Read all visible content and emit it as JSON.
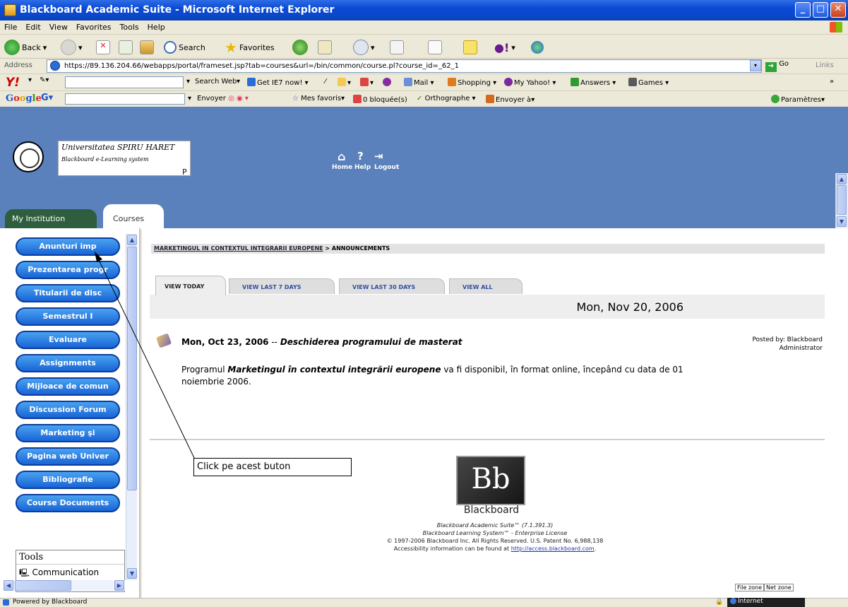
{
  "window": {
    "title": "Blackboard Academic Suite - Microsoft Internet Explorer"
  },
  "menu": [
    "File",
    "Edit",
    "View",
    "Favorites",
    "Tools",
    "Help"
  ],
  "toolbar": {
    "back": "Back",
    "search": "Search",
    "favorites": "Favorites"
  },
  "address": {
    "label": "Address",
    "url": "https://89.136.204.66/webapps/portal/frameset.jsp?tab=courses&url=/bin/common/course.pl?course_id=_62_1",
    "go": "Go",
    "links": "Links"
  },
  "yahoo": {
    "search_web": "Search Web",
    "get_ie7": "Get IE7 now!",
    "mail": "Mail",
    "shopping": "Shopping",
    "my_yahoo": "My Yahoo!",
    "answers": "Answers",
    "games": "Games"
  },
  "google": {
    "envoyer": "Envoyer",
    "favoris": "Mes favoris",
    "bloquees": "0 bloquée(s)",
    "orthographe": "Orthographe",
    "envoyer_a": "Envoyer à",
    "parametres": "Paramètres"
  },
  "header": {
    "university": "Universitatea SPIRU HARET",
    "subtitle": "Blackboard e-Learning system",
    "home": "Home",
    "help": "Help",
    "logout": "Logout",
    "p_mark": "P"
  },
  "tabs": {
    "institution": "My Institution",
    "courses": "Courses"
  },
  "course_menu": [
    "Anunturi imp",
    "Prezentarea progr",
    "Titularii de disc",
    "Semestrul I",
    "Evaluare",
    "Assignments",
    "Mijloace de comun",
    "Discussion Forum",
    "Marketing şi",
    "Pagina web Univer",
    "Bibliografie",
    "Course Documents"
  ],
  "tools": {
    "header": "Tools",
    "item": "Communication"
  },
  "breadcrumb": {
    "course": "MARKETINGUL IN CONTEXTUL INTEGRARII EUROPENE",
    "sep": " > ",
    "page": "ANNOUNCEMENTS"
  },
  "view_tabs": [
    "VIEW TODAY",
    "VIEW LAST 7 DAYS",
    "VIEW LAST 30 DAYS",
    "VIEW ALL"
  ],
  "current_date": "Mon, Nov 20, 2006",
  "announcement": {
    "date": "Mon, Oct 23, 2006",
    "dash": " -- ",
    "title": "Deschiderea programului de masterat",
    "posted_by": "Posted by: Blackboard Administrator",
    "body_pre": "Programul ",
    "body_bold": "Marketingul în contextul integrării europene",
    "body_post": " va fi disponibil, în format online, începând cu data de 01 noiembrie 2006."
  },
  "footer": {
    "bb_logo": "Bb",
    "brand": "Blackboard",
    "line1": "Blackboard Academic Suite™ (7.1.391.3)",
    "line2": "Blackboard Learning System™ - Enterprise License",
    "line3": "© 1997-2006 Blackboard Inc. All Rights Reserved. U.S. Patent No. 6,988,138",
    "line4_pre": "Accessibility information can be found at ",
    "line4_link": "http://access.blackboard.com",
    "line4_post": "."
  },
  "callout": "Click pe acest buton",
  "status": {
    "text": "Powered by Blackboard",
    "file_zone": "File zone",
    "net_zone": "Net zone",
    "internet": "Internet"
  }
}
